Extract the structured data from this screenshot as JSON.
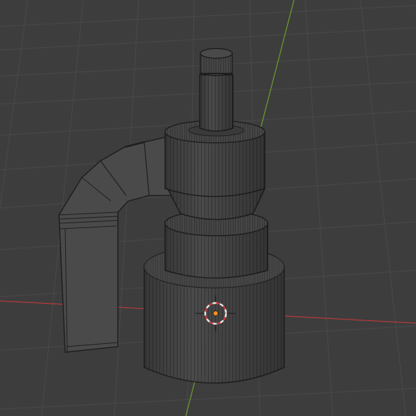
{
  "viewport": {
    "mode": "wireframe",
    "background_color": "#3d3d3d",
    "grid_color": "#4a4a4a",
    "x_axis_color": "#b33a3a",
    "y_axis_color": "#6b9a2b",
    "wire_color": "#1e1e1e",
    "mesh_face_color": "#4a4a4a",
    "cursor_colors": [
      "#e8e8e8",
      "#d23a3a"
    ],
    "origin_color": "#ff8c1a"
  },
  "object": {
    "name_icon": "mesh-object",
    "parts": [
      "spout-arm",
      "top-stem",
      "head-cylinder",
      "head-taper",
      "middle-collar",
      "base-cylinder"
    ]
  }
}
